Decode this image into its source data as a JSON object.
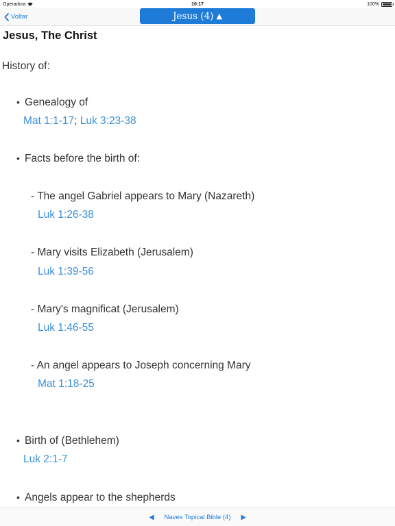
{
  "status_bar": {
    "carrier": "Operadora",
    "time": "10:17",
    "battery": "100%"
  },
  "nav": {
    "back_label": "Voltar",
    "title": "Jesus (4)",
    "title_caret": "▲"
  },
  "content": {
    "topic_title": "Jesus, The Christ",
    "section_label": "History of:",
    "entries": {
      "genealogy": {
        "text": "Genealogy of",
        "refs": [
          "Mat 1:1-17",
          "Luk 3:23-38"
        ],
        "separator": ";"
      },
      "facts_before_birth": {
        "text": "Facts before the birth of:"
      },
      "gabriel": {
        "text": "- The angel Gabriel appears to Mary (Nazareth)",
        "ref": "Luk 1:26-38"
      },
      "mary_visits": {
        "text": "- Mary visits Elizabeth (Jerusalem)",
        "ref": "Luk 1:39-56"
      },
      "magnificat": {
        "text": "- Mary's magnificat (Jerusalem)",
        "ref": "Luk 1:46-55"
      },
      "joseph": {
        "text": "- An angel appears to Joseph concerning Mary",
        "ref": "Mat 1:18-25"
      },
      "birth": {
        "text": "Birth of (Bethlehem)",
        "ref": "Luk 2:1-7"
      },
      "shepherds": {
        "text": "Angels appear to the shepherds"
      }
    },
    "bullet": "•"
  },
  "bottom_bar": {
    "source_label": "Naves Topical Bible (4)"
  },
  "colors": {
    "accent": "#1f7bd8",
    "link": "#3b8fd8"
  },
  "icons": {
    "back": "chevron-left-icon",
    "prev": "triangle-left-icon",
    "next": "triangle-right-icon",
    "wifi": "wifi-icon",
    "battery": "battery-icon"
  }
}
